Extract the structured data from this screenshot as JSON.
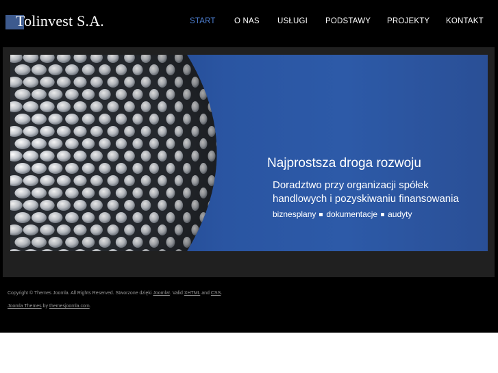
{
  "brand": {
    "name": "Tolinvest S.A.",
    "accent": "#3d5a8e"
  },
  "nav": {
    "items": [
      {
        "label": "START",
        "active": true
      },
      {
        "label": "O NAS"
      },
      {
        "label": "USŁUGI"
      },
      {
        "label": "PODSTAWY"
      },
      {
        "label": "PROJEKTY"
      },
      {
        "label": "KONTAKT"
      }
    ],
    "active_color": "#4d7fd1"
  },
  "banner": {
    "title": "Najprostsza droga rozwoju",
    "subtitle_line1": "Doradztwo przy organizacji spółek",
    "subtitle_line2": "handlowych i pozyskiwaniu finansowania",
    "tags": [
      "biznesplany",
      "dokumentacje",
      "audyty"
    ]
  },
  "footer": {
    "copyright": "Copyright © Themes Joomla. All Rights Reserved. Stworzone dzięki",
    "joomla_link": "Joomla!",
    "valid": ". Valid",
    "xhtml_link": "XHTML",
    "and": "and",
    "css_link": "CSS",
    "end": ".",
    "themes_link": "Joomla Themes",
    "by": "by",
    "site_link": "themesjoomla.com",
    "end2": "."
  }
}
